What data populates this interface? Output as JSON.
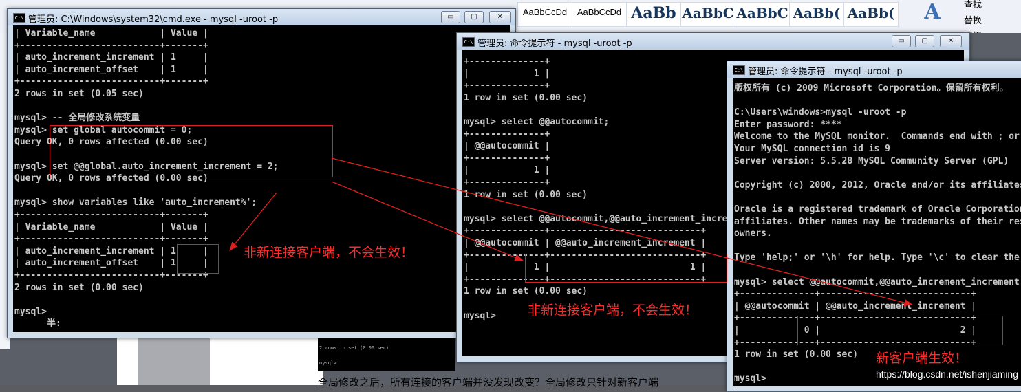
{
  "ribbon": {
    "styles": [
      "AaBbCcDd",
      "AaBbCcDd",
      "AaBb",
      "AaBbC",
      "AaBbC",
      "AaBb(",
      "AaBb("
    ],
    "right_items": [
      "查找",
      "替换",
      "选择"
    ]
  },
  "doc": {
    "bottom_text": "全局修改之后，所有连接的客户端并没发现改变？全局修改只针对新客户端",
    "thumb_line1": "2 rows in set (0.00 sec)",
    "thumb_line2": "mysql>"
  },
  "win1": {
    "title": "管理员: C:\\Windows\\system32\\cmd.exe - mysql  -uroot -p",
    "lines": [
      "| Variable_name            | Value |",
      "+--------------------------+-------+",
      "| auto_increment_increment | 1     |",
      "| auto_increment_offset    | 1     |",
      "+--------------------------+-------+",
      "2 rows in set (0.05 sec)",
      "",
      "mysql> -- 全局修改系统变量",
      "mysql> set global autocommit = 0;",
      "Query OK, 0 rows affected (0.00 sec)",
      "",
      "mysql> set @@global.auto_increment_increment = 2;",
      "Query OK, 0 rows affected (0.00 sec)",
      "",
      "mysql> show variables like 'auto_increment%';",
      "+--------------------------+-------+",
      "| Variable_name            | Value |",
      "+--------------------------+-------+",
      "| auto_increment_increment | 1     |",
      "| auto_increment_offset    | 1     |",
      "+--------------------------+-------+",
      "2 rows in set (0.00 sec)",
      "",
      "mysql>",
      "      半:"
    ],
    "annotation": "非新连接客户端，不会生效！"
  },
  "win2": {
    "title": "管理员: 命令提示符 - mysql  -uroot -p",
    "lines": [
      "+--------------+",
      "|            1 |",
      "+--------------+",
      "1 row in set (0.00 sec)",
      "",
      "mysql> select @@autocommit;",
      "+--------------+",
      "| @@autocommit |",
      "+--------------+",
      "|            1 |",
      "+--------------+",
      "1 row in set (0.00 sec)",
      "",
      "mysql> select @@autocommit,@@auto_increment_increment;",
      "+--------------+----------------------------+",
      "| @@autocommit | @@auto_increment_increment |",
      "+--------------+----------------------------+",
      "|            1 |                          1 |",
      "+--------------+----------------------------+",
      "1 row in set (0.00 sec)",
      "",
      "mysql>"
    ],
    "annotation": "非新连接客户端，不会生效！"
  },
  "win3": {
    "title": "管理员: 命令提示符 - mysql  -uroot -p",
    "lines": [
      "版权所有 (c) 2009 Microsoft Corporation。保留所有权利。",
      "",
      "C:\\Users\\windows>mysql -uroot -p",
      "Enter password: ****",
      "Welcome to the MySQL monitor.  Commands end with ; or \\g.",
      "Your MySQL connection id is 9",
      "Server version: 5.5.28 MySQL Community Server (GPL)",
      "",
      "Copyright (c) 2000, 2012, Oracle and/or its affiliates.",
      "",
      "Oracle is a registered trademark of Oracle Corporation and/or its",
      "affiliates. Other names may be trademarks of their respective",
      "owners.",
      "",
      "Type 'help;' or '\\h' for help. Type '\\c' to clear the current input statement.",
      "",
      "mysql> select @@autocommit,@@auto_increment_increment;",
      "+--------------+----------------------------+",
      "| @@autocommit | @@auto_increment_increment |",
      "+--------------+----------------------------+",
      "|            0 |                          2 |",
      "+--------------+----------------------------+",
      "1 row in set (0.00 sec)",
      "",
      "mysql>"
    ],
    "annotation": "新客户端生效！"
  },
  "watermark": "https://blog.csdn.net/ishenjiaming",
  "window_buttons": {
    "minimize": "▭",
    "maximize": "▢",
    "close": "✕"
  }
}
